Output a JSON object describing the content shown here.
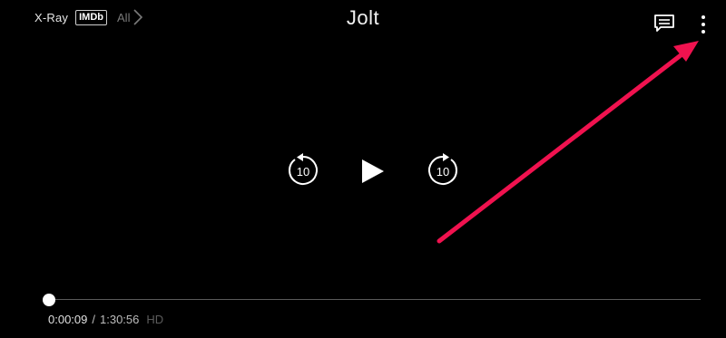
{
  "xray": {
    "label": "X-Ray",
    "imdb_badge": "IMDb",
    "all_label": "All",
    "chevron_icon": "chevron-right-icon"
  },
  "title": "Jolt",
  "top_right": {
    "subtitles_icon": "subtitles-icon",
    "more_icon": "more-vertical-icon"
  },
  "controls": {
    "rewind": {
      "icon": "rewind-10-icon",
      "label": "10"
    },
    "play": {
      "icon": "play-icon"
    },
    "forward": {
      "icon": "forward-10-icon",
      "label": "10"
    }
  },
  "annotation": {
    "icon": "arrow-annotation",
    "color": "#f0124f"
  },
  "playback": {
    "current_time": "0:00:09",
    "separator": "/",
    "total_time": "1:30:56",
    "quality": "HD",
    "progress_fraction": 0.0017
  }
}
